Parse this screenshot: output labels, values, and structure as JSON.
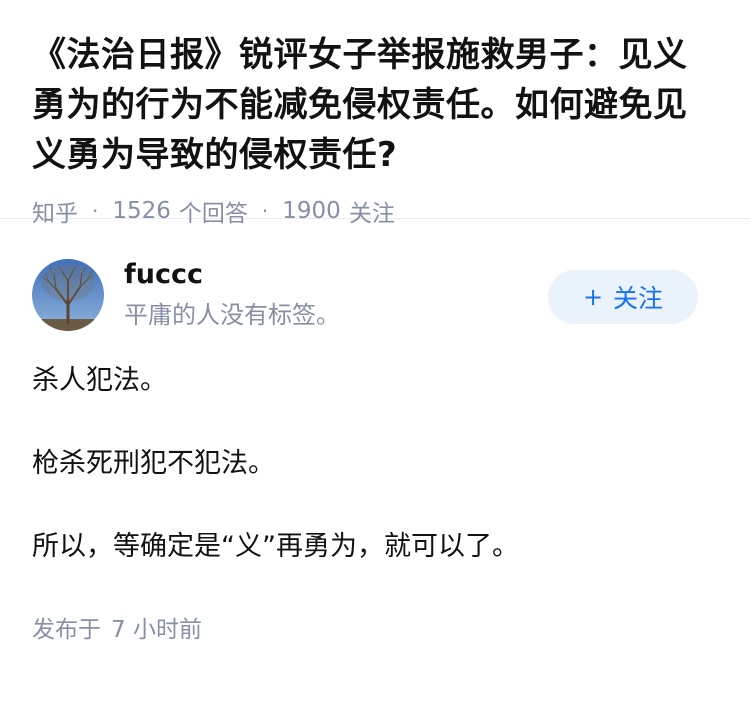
{
  "question": {
    "title": "《法治日报》锐评女子举报施救男子：见义勇为的行为不能减免侵权责任。如何避免见义勇为导致的侵权责任?",
    "source": "知乎",
    "answers_count": "1526",
    "answers_label": "个回答",
    "followers_count": "1900",
    "followers_label": "关注"
  },
  "answer": {
    "author": {
      "name": "fuccc",
      "bio": "平庸的人没有标签。",
      "avatar_icon": "tree-avatar"
    },
    "follow_button": {
      "icon": "+",
      "label": "关注"
    },
    "paragraphs": [
      "杀人犯法。",
      "枪杀死刑犯不犯法。",
      "所以，等确定是“义”再勇为，就可以了。"
    ],
    "posted_prefix": "发布于",
    "posted_time": "7 小时前"
  },
  "colors": {
    "meta_gray": "#8590a6",
    "accent_blue": "#1772f6",
    "follow_bg": "#eaf2fc",
    "text": "#121212"
  }
}
